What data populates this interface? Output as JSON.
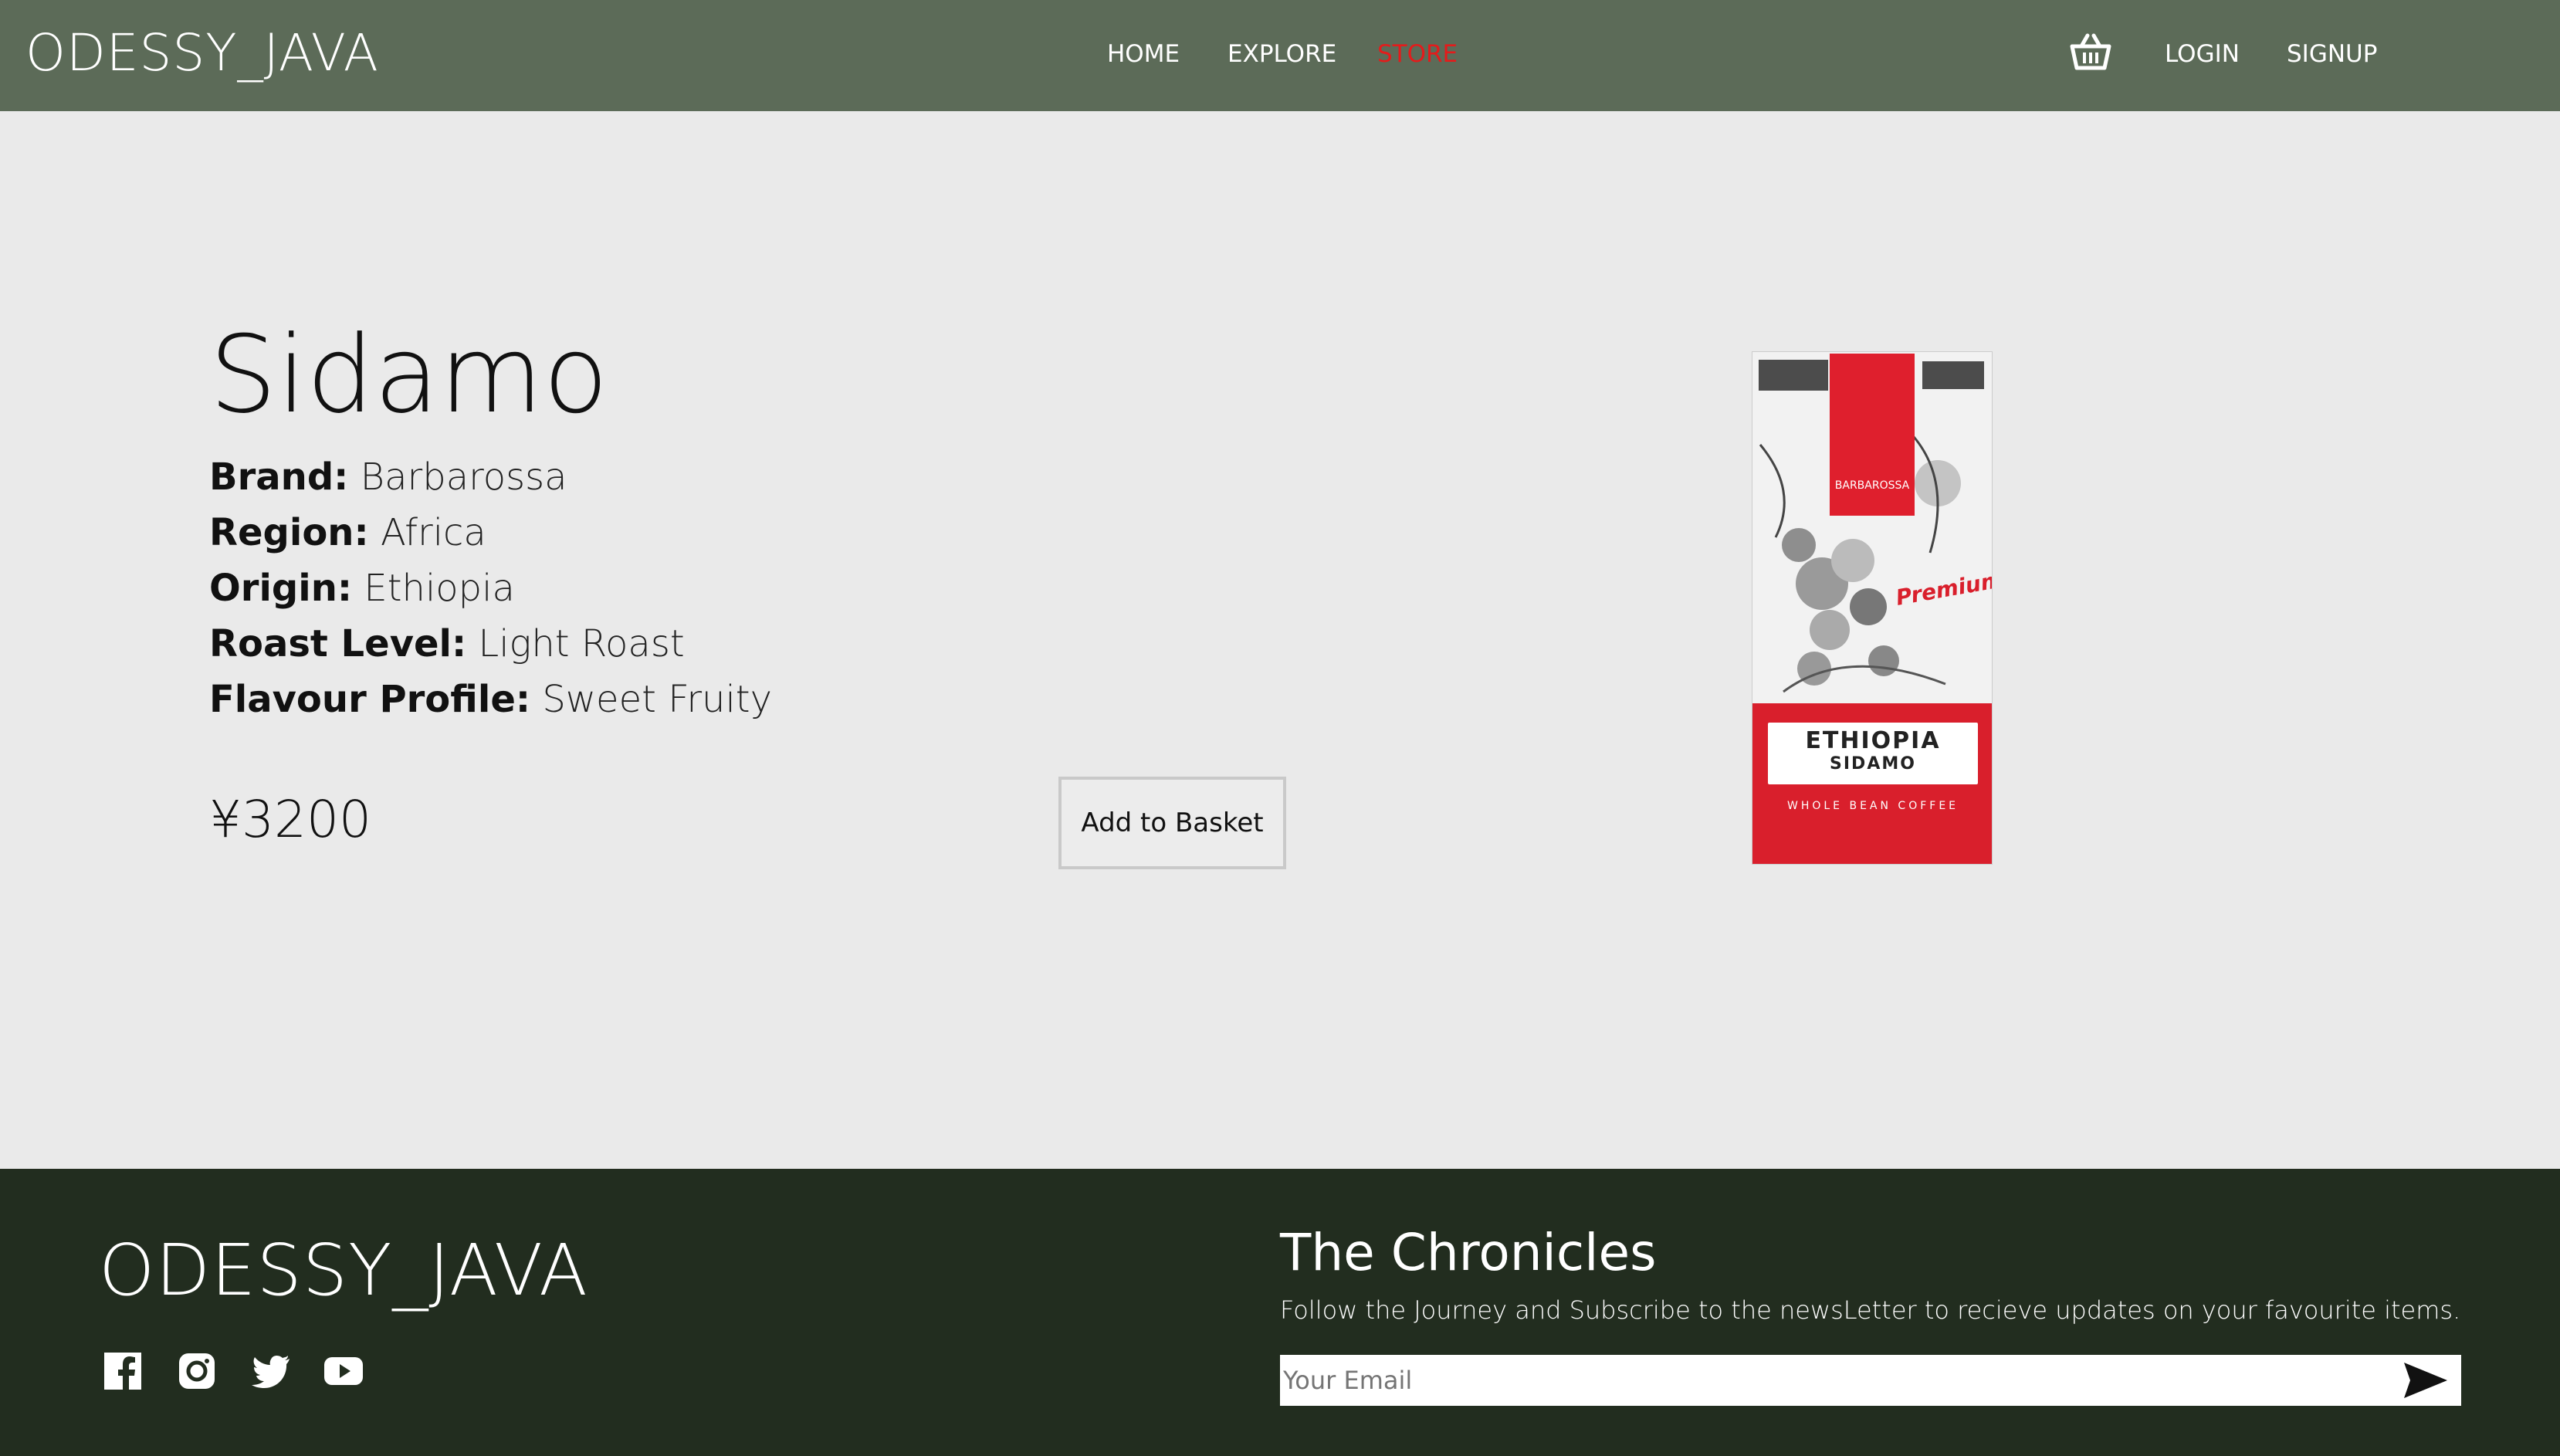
{
  "header": {
    "logo": "ODESSY_JAVA",
    "nav": [
      {
        "label": "HOME"
      },
      {
        "label": "EXPLORE"
      },
      {
        "label": "STORE"
      }
    ],
    "active_nav": "STORE",
    "login": "LOGIN",
    "signup": "SIGNUP",
    "cart_icon": "basket-icon"
  },
  "product": {
    "name": "Sidamo",
    "specs": [
      {
        "key": "Brand:",
        "value": "Barbarossa"
      },
      {
        "key": "Region:",
        "value": "Africa"
      },
      {
        "key": "Origin:",
        "value": "Ethiopia"
      },
      {
        "key": "Roast Level:",
        "value": "Light Roast"
      },
      {
        "key": "Flavour Profile:",
        "value": "Sweet Fruity"
      }
    ],
    "price": "¥3200",
    "add_to_basket": "Add to Basket",
    "image": {
      "label_line1": "ETHIOPIA",
      "label_line2": "SIDAMO",
      "brand_text": "BARBAROSSA",
      "badge_text": "Premium",
      "bottom_text": "WHOLE BEAN COFFEE"
    }
  },
  "footer": {
    "logo": "ODESSY_JAVA",
    "social_icons": [
      "facebook-icon",
      "instagram-icon",
      "twitter-icon",
      "youtube-icon"
    ],
    "newsletter_title": "The Chronicles",
    "newsletter_text": "Follow the Journey and Subscribe to the newsLetter to recieve updates on your favourite items.",
    "email_placeholder": "Your Email",
    "send_icon": "send-arrow-icon"
  },
  "colors": {
    "header_bg": "#5c6b58",
    "active_nav": "#e51b1b",
    "page_bg": "#eaeaea",
    "footer_bg": "#222d1f",
    "bag_red": "#d91f2c"
  }
}
